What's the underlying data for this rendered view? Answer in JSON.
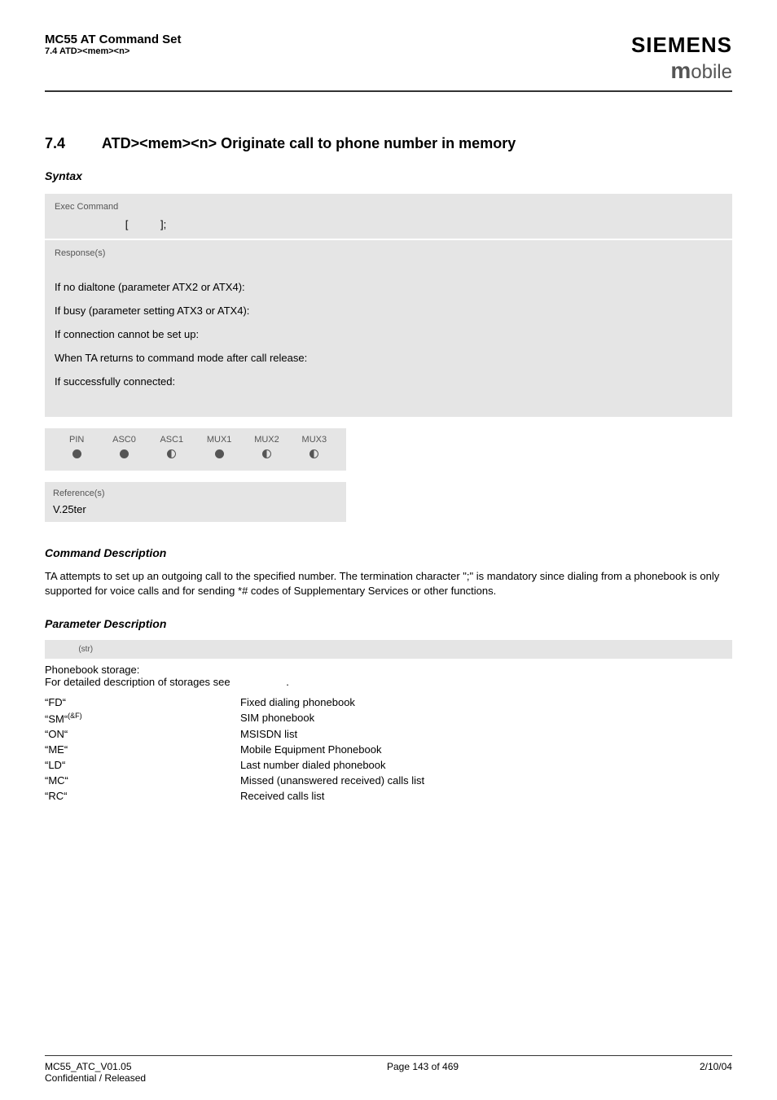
{
  "header": {
    "title": "MC55 AT Command Set",
    "sub": "7.4 ATD><mem><n>",
    "brand": "SIEMENS",
    "brand2_m": "m",
    "brand2_rest": "obile"
  },
  "section": {
    "num": "7.4",
    "title": "ATD><mem><n>   Originate call to phone number in memory"
  },
  "syntax_label": "Syntax",
  "exec": {
    "label": "Exec Command",
    "open": "[",
    "close": "];"
  },
  "resp": {
    "label": "Response(s)",
    "l1": "If no dialtone (parameter ATX2 or ATX4):",
    "l2": "If busy (parameter setting ATX3 or ATX4):",
    "l3": "If connection cannot be set up:",
    "l4": "When TA returns to command mode after call release:",
    "l5": "If successfully connected:"
  },
  "mux": {
    "h": [
      "PIN",
      "ASC0",
      "ASC1",
      "MUX1",
      "MUX2",
      "MUX3"
    ]
  },
  "ref": {
    "label": "Reference(s)",
    "val": "V.25ter"
  },
  "cmd_desc_h": "Command Description",
  "cmd_desc": "TA attempts to set up an outgoing call to the specified number. The termination character \";\" is mandatory since dialing from a phonebook is only supported for voice calls and for sending *# codes of Supplementary Services or other functions.",
  "param_desc_h": "Parameter Description",
  "param_str": "(str)",
  "storage_desc_1": "Phonebook storage:",
  "storage_desc_2a": "For detailed description of storages see ",
  "storage_desc_2b": ".",
  "values": [
    {
      "k": "“FD“",
      "v": "Fixed dialing phonebook"
    },
    {
      "k": "“SM“",
      "sup": "(&F)",
      "v": "SIM phonebook"
    },
    {
      "k": "“ON“",
      "v": "MSISDN list"
    },
    {
      "k": "“ME“",
      "v": "Mobile Equipment Phonebook"
    },
    {
      "k": "“LD“",
      "v": "Last number dialed phonebook"
    },
    {
      "k": "“MC“",
      "v": "Missed (unanswered received) calls list"
    },
    {
      "k": "“RC“",
      "v": "Received calls list"
    }
  ],
  "footer": {
    "l1": "MC55_ATC_V01.05",
    "l2": "Confidential / Released",
    "mid": "Page 143 of 469",
    "right": "2/10/04"
  }
}
